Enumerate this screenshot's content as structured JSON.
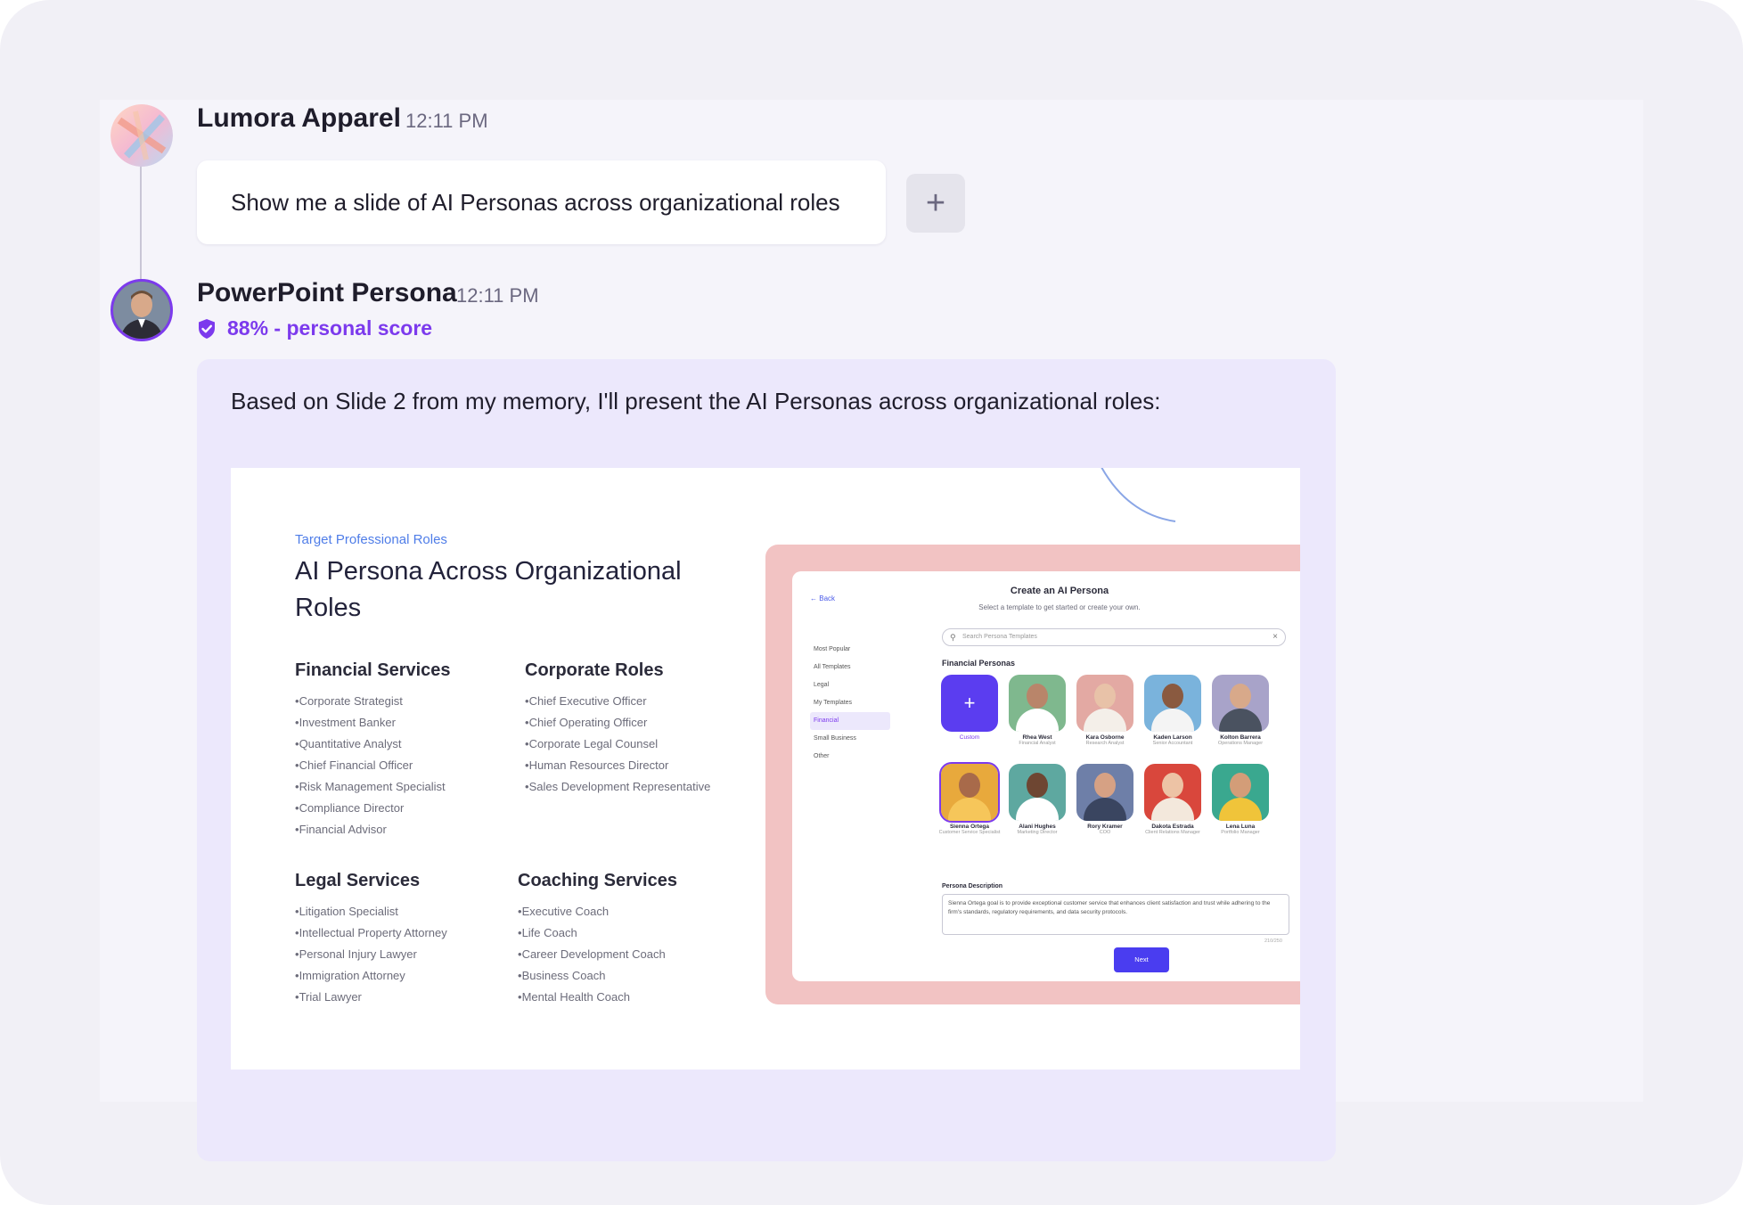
{
  "colors": {
    "accent": "#7c3aed",
    "bot_bubble": "#ece8fc",
    "slide_link": "#4f7de8",
    "mock_frame": "#f2c3c3",
    "mock_button": "#4a3df0"
  },
  "messages": {
    "user": {
      "sender": "Lumora Apparel",
      "time": "12:11 PM",
      "text": "Show me a slide of AI Personas across organizational roles",
      "add_icon": "plus-icon"
    },
    "bot": {
      "sender": "PowerPoint Persona",
      "time": "12:11 PM",
      "score_icon": "shield-check-icon",
      "score": "88% - personal score",
      "text": "Based on Slide 2 from my memory, I'll present the AI Personas across organizational roles:"
    }
  },
  "slide": {
    "eyebrow": "Target Professional Roles",
    "title": "AI Persona Across Organizational Roles",
    "sections": [
      {
        "heading": "Financial Services",
        "items": [
          "Corporate Strategist",
          "Investment Banker",
          "Quantitative Analyst",
          "Chief Financial Officer",
          "Risk Management Specialist",
          "Compliance Director",
          "Financial Advisor"
        ]
      },
      {
        "heading": "Corporate Roles",
        "items": [
          "Chief Executive Officer",
          "Chief Operating Officer",
          "Corporate Legal Counsel",
          "Human Resources Director",
          "Sales Development Representative"
        ]
      },
      {
        "heading": "Legal Services",
        "items": [
          "Litigation Specialist",
          "Intellectual Property Attorney",
          "Personal Injury Lawyer",
          "Immigration Attorney",
          "Trial Lawyer"
        ]
      },
      {
        "heading": "Coaching Services",
        "items": [
          "Executive Coach",
          "Life Coach",
          "Career Development Coach",
          "Business Coach",
          "Mental Health Coach"
        ]
      }
    ],
    "mock": {
      "back": "Back",
      "title": "Create an AI Persona",
      "subtitle": "Select a template to get started or create your own.",
      "search_placeholder": "Search Persona Templates",
      "sidebar": [
        "Most Popular",
        "All Templates",
        "Legal",
        "My Templates",
        "Financial",
        "Small Business",
        "Other"
      ],
      "section": "Financial Personas",
      "personas_row1": [
        {
          "name": "Custom",
          "role": ""
        },
        {
          "name": "Rhea West",
          "role": "Financial Analyst"
        },
        {
          "name": "Kara Osborne",
          "role": "Research Analyst"
        },
        {
          "name": "Kaden Larson",
          "role": "Senior Accountant"
        },
        {
          "name": "Kolton Barrera",
          "role": "Operations Manager"
        }
      ],
      "personas_row2": [
        {
          "name": "Sienna Ortega",
          "role": "Customer Service Specialist"
        },
        {
          "name": "Alani Hughes",
          "role": "Marketing Director"
        },
        {
          "name": "Rory Kramer",
          "role": "COO"
        },
        {
          "name": "Dakota Estrada",
          "role": "Client Relations Manager"
        },
        {
          "name": "Lena Luna",
          "role": "Portfolio Manager"
        }
      ],
      "description_label": "Persona Description",
      "description": "Sienna Ortega goal is to provide exceptional customer service that enhances client satisfaction and trust while adhering to the firm's standards, regulatory requirements, and data security protocols.",
      "counter": "210/250",
      "next": "Next"
    }
  }
}
